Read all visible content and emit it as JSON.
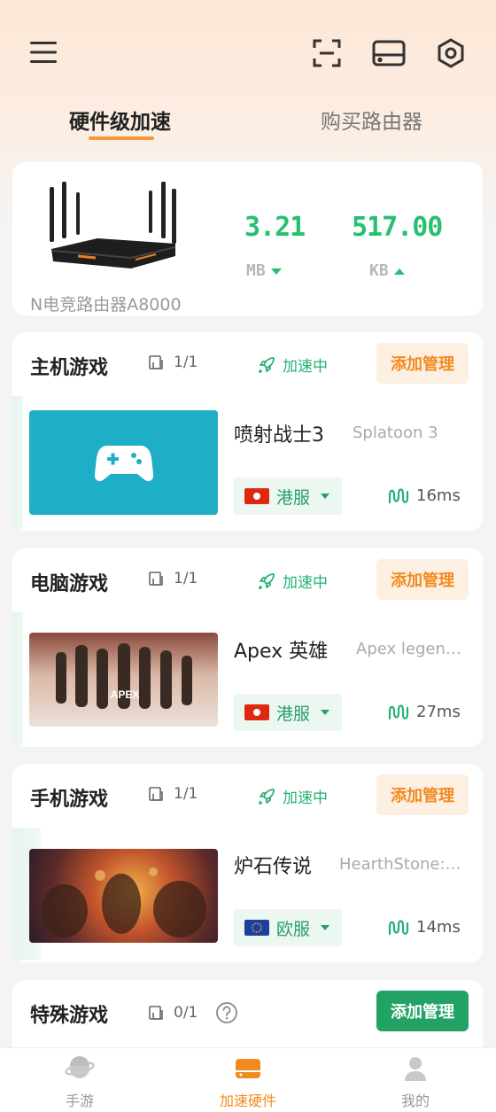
{
  "tabs": [
    {
      "label": "硬件级加速",
      "active": true
    },
    {
      "label": "购买路由器",
      "active": false
    }
  ],
  "router": {
    "name": "N电竞路由器A8000",
    "download_value": "3.21",
    "download_unit": "MB",
    "upload_value": "517.00",
    "upload_unit": "KB"
  },
  "sections": [
    {
      "title": "主机游戏",
      "count": "1/1",
      "status": "加速中",
      "add_label": "添加管理",
      "game": {
        "name": "喷射战士3",
        "en_name": "Splatoon 3",
        "region": "港服",
        "ping": "16ms"
      }
    },
    {
      "title": "电脑游戏",
      "count": "1/1",
      "status": "加速中",
      "add_label": "添加管理",
      "game": {
        "name": "Apex 英雄",
        "en_name": "Apex legen…",
        "region": "港服",
        "ping": "27ms",
        "logo": "APEX"
      }
    },
    {
      "title": "手机游戏",
      "count": "1/1",
      "status": "加速中",
      "add_label": "添加管理",
      "game": {
        "name": "炉石传说",
        "en_name": "HearthStone:…",
        "region": "欧服",
        "ping": "14ms"
      }
    },
    {
      "title": "特殊游戏",
      "count": "0/1",
      "add_label": "添加管理"
    }
  ],
  "nav": [
    {
      "label": "手游",
      "icon": "planet-icon",
      "active": false
    },
    {
      "label": "加速硬件",
      "icon": "hardware-icon",
      "active": true
    },
    {
      "label": "我的",
      "icon": "user-icon",
      "active": false
    }
  ],
  "colors": {
    "accent_orange": "#f08b20",
    "accent_green": "#27c071",
    "button_green": "#22a365",
    "console_bg": "#1eafc6"
  }
}
